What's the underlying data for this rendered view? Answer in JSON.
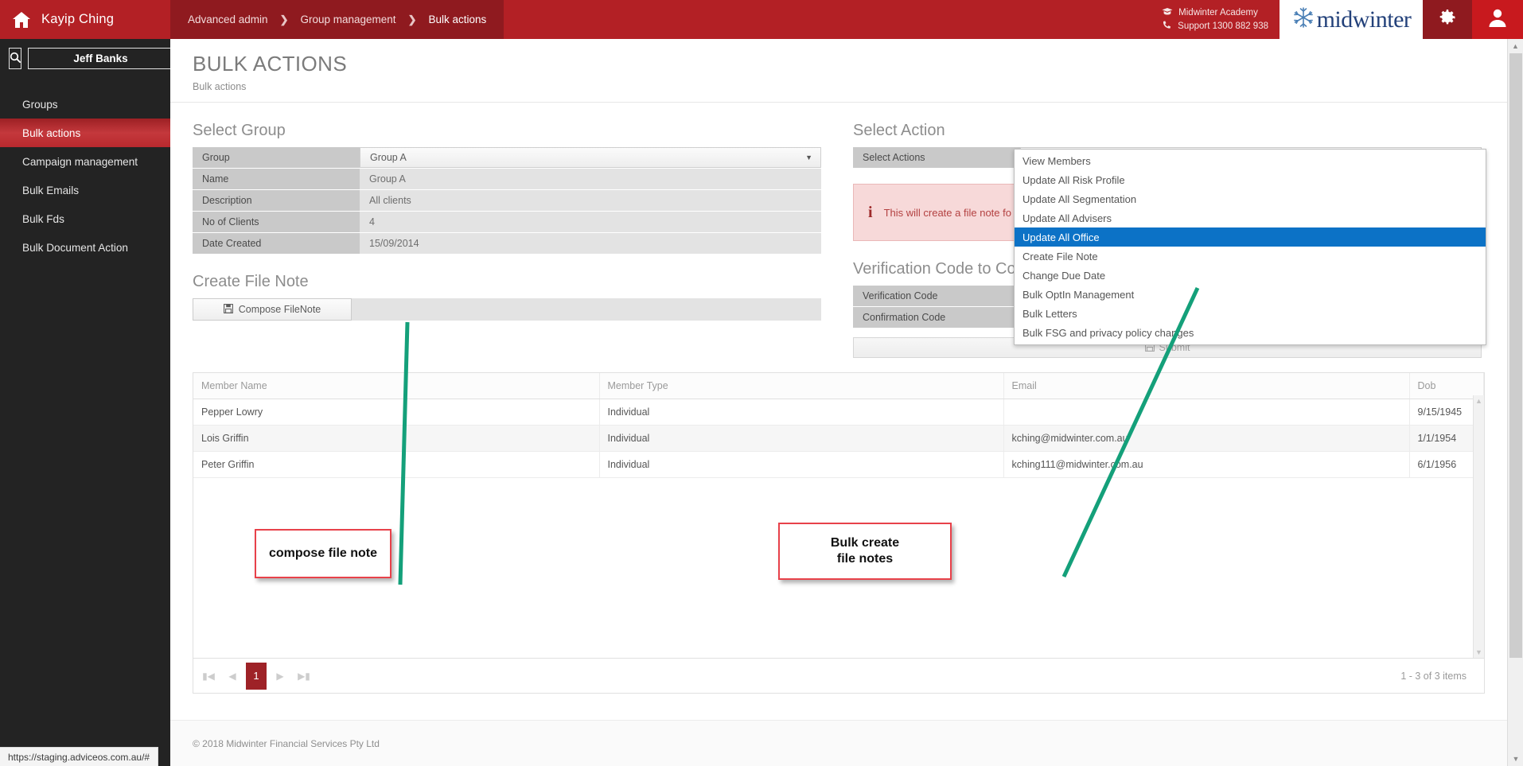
{
  "topbar": {
    "home_icon": "home-icon",
    "brand_name": "Kayip Ching",
    "breadcrumbs": [
      {
        "label": "Advanced admin"
      },
      {
        "label": "Group management"
      },
      {
        "label": "Bulk actions"
      }
    ],
    "breadcrumb_separator": "❯",
    "academy_label": "Midwinter Academy",
    "academy_icon": "graduation-cap-icon",
    "support_label": "Support 1300 882 938",
    "support_icon": "phone-icon",
    "logo_text": "midwinter",
    "logo_icon": "snowflake-icon",
    "gear_icon": "gear-icon",
    "avatar_icon": "user-avatar-icon",
    "brand_color": "#b32025",
    "breadcrumb_bg": "#8f1a1f"
  },
  "sidebar": {
    "search_icon": "search-icon",
    "search_value": "Jeff Banks",
    "search_placeholder": "Search",
    "items": [
      {
        "label": "Groups",
        "selected": false
      },
      {
        "label": "Bulk actions",
        "selected": true
      },
      {
        "label": "Campaign management",
        "selected": false
      },
      {
        "label": "Bulk Emails",
        "selected": false
      },
      {
        "label": "Bulk Fds",
        "selected": false
      },
      {
        "label": "Bulk Document Action",
        "selected": false
      }
    ]
  },
  "page": {
    "title": "BULK ACTIONS",
    "subtitle": "Bulk actions"
  },
  "select_group": {
    "heading": "Select Group",
    "rows": [
      {
        "key": "Group",
        "value": "Group A",
        "type": "select"
      },
      {
        "key": "Name",
        "value": "Group A",
        "type": "text"
      },
      {
        "key": "Description",
        "value": "All clients",
        "type": "text"
      },
      {
        "key": "No of Clients",
        "value": "4",
        "type": "text"
      },
      {
        "key": "Date Created",
        "value": "15/09/2014",
        "type": "text"
      }
    ]
  },
  "select_action": {
    "heading": "Select Action",
    "label": "Select Actions",
    "selected": "Create File Note",
    "options": [
      {
        "label": "View Members",
        "highlighted": false
      },
      {
        "label": "Update All Risk Profile",
        "highlighted": false
      },
      {
        "label": "Update All Segmentation",
        "highlighted": false
      },
      {
        "label": "Update All Advisers",
        "highlighted": false
      },
      {
        "label": "Update All Office",
        "highlighted": true
      },
      {
        "label": "Create File Note",
        "highlighted": false
      },
      {
        "label": "Change Due Date",
        "highlighted": false
      },
      {
        "label": "Bulk OptIn Management",
        "highlighted": false
      },
      {
        "label": "Bulk Letters",
        "highlighted": false
      },
      {
        "label": "Bulk FSG and privacy policy changes",
        "highlighted": false
      }
    ],
    "highlight_color": "#0c72c6",
    "alert_icon": "info-icon",
    "alert_text": "This will create a file note fo"
  },
  "create_file_note": {
    "heading": "Create File Note",
    "compose_icon": "save-disk-icon",
    "compose_label": "Compose FileNote"
  },
  "verification": {
    "heading": "Verification Code to Co",
    "rows": [
      {
        "key": "Verification Code",
        "value": ""
      },
      {
        "key": "Confirmation Code",
        "value": ""
      }
    ],
    "submit_icon": "save-disk-icon",
    "submit_label": "Submit"
  },
  "members_table": {
    "columns": [
      "Member Name",
      "Member Type",
      "Email",
      "Dob"
    ],
    "rows": [
      {
        "name": "Pepper Lowry",
        "type": "Individual",
        "email": "",
        "dob": "9/15/1945"
      },
      {
        "name": "Lois Griffin",
        "type": "Individual",
        "email": "kching@midwinter.com.au",
        "dob": "1/1/1954"
      },
      {
        "name": "Peter Griffin",
        "type": "Individual",
        "email": "kching111@midwinter.com.au",
        "dob": "6/1/1956"
      }
    ]
  },
  "pagination": {
    "first_icon": "first-page-icon",
    "prev_icon": "prev-page-icon",
    "next_icon": "next-page-icon",
    "last_icon": "last-page-icon",
    "current_page": "1",
    "info": "1 - 3 of 3 items"
  },
  "footer": {
    "copyright": "© 2018 Midwinter Financial Services Pty Ltd"
  },
  "annotations": {
    "compose_note": "compose file note",
    "bulk_create": "Bulk create\nfile notes",
    "bulk_create_line1": "Bulk create",
    "bulk_create_line2": "file notes",
    "arrow_color": "#14a07a",
    "box_border_color": "#e8414a"
  },
  "statusbar": {
    "url": "https://staging.adviceos.com.au/#"
  }
}
